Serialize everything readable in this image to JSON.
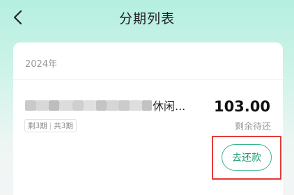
{
  "header": {
    "title": "分期列表",
    "back_icon": "chevron-left-icon"
  },
  "card": {
    "year": "2024年",
    "item": {
      "name_visible_suffix": "休闲...",
      "tag_remaining": "剩3期",
      "tag_total": "共3期",
      "amount": "103.00",
      "amount_label": "剩余待还"
    },
    "repay_button_label": "去还款"
  },
  "colors": {
    "accent": "#35b48c",
    "highlight": "#e53935"
  }
}
